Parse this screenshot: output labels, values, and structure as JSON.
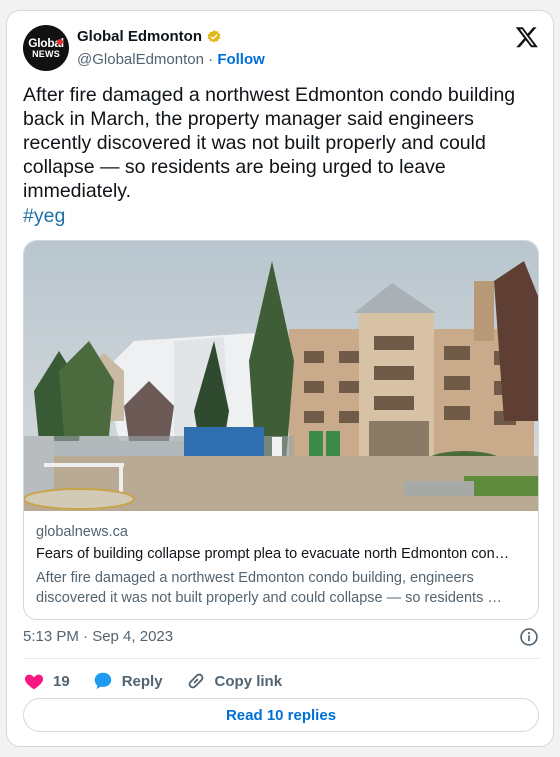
{
  "account": {
    "name": "Global Edmonton",
    "handle": "@GlobalEdmonton",
    "separator": "·",
    "follow_label": "Follow",
    "avatar_line1": "Global",
    "avatar_line2": "NEWS",
    "verified_badge_color": "#e2b719"
  },
  "tweet": {
    "text": "After fire damaged a northwest Edmonton condo building back in March, the property manager said engineers recently discovered it was not built properly and could collapse — so residents are being urged to leave immediately.",
    "hashtag": "#yeg"
  },
  "link_card": {
    "domain": "globalnews.ca",
    "headline": "Fears of building collapse prompt plea to evacuate north Edmonton con…",
    "description": "After fire damaged a northwest Edmonton condo building, engineers discovered it was not built properly and could collapse — so residents …"
  },
  "meta": {
    "timestamp": "5:13 PM · Sep 4, 2023"
  },
  "actions": {
    "likes": "19",
    "reply_label": "Reply",
    "copy_label": "Copy link"
  },
  "read_replies_label": "Read 10 replies",
  "colors": {
    "link_blue": "#006fd6",
    "hashtag_blue": "#1d6fa5",
    "like_pink": "#f91880",
    "reply_blue": "#1d9bf0",
    "muted_text": "#536471",
    "border": "#cfd9de"
  },
  "icons": [
    "verified-badge-icon",
    "x-logo-icon",
    "info-icon",
    "heart-icon",
    "reply-bubble-icon",
    "link-icon"
  ]
}
